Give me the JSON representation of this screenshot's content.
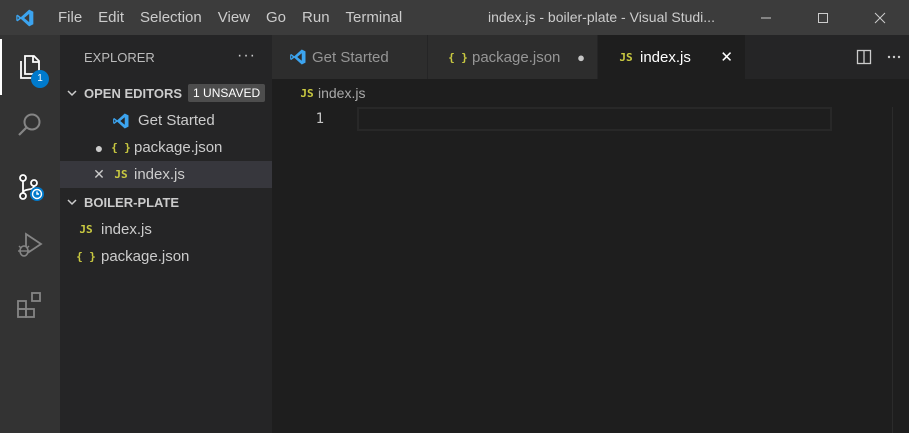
{
  "titlebar": {
    "menu": [
      "File",
      "Edit",
      "Selection",
      "View",
      "Go",
      "Run",
      "Terminal"
    ],
    "window_title": "index.js - boiler-plate - Visual Studi..."
  },
  "activity": {
    "explorer_badge": "1"
  },
  "sidebar": {
    "title": "EXPLORER",
    "more": "···",
    "open_editors": {
      "label": "OPEN EDITORS",
      "badge": "1 UNSAVED",
      "items": [
        {
          "label": "Get Started",
          "icon": "vscode-icon"
        },
        {
          "label": "package.json",
          "icon": "json-icon",
          "lead": "●"
        },
        {
          "label": "index.js",
          "icon": "js-icon",
          "lead": "✕"
        }
      ]
    },
    "project": {
      "label": "BOILER-PLATE",
      "items": [
        {
          "label": "index.js",
          "icon": "js-icon"
        },
        {
          "label": "package.json",
          "icon": "json-icon"
        }
      ]
    }
  },
  "tabs": [
    {
      "label": "Get Started",
      "icon": "vscode-icon"
    },
    {
      "label": "package.json",
      "icon": "json-icon",
      "dirty": "●"
    },
    {
      "label": "index.js",
      "icon": "js-icon",
      "close": "✕"
    }
  ],
  "icon_text": {
    "js": "JS",
    "json": "{ }"
  },
  "breadcrumb": {
    "file": "index.js"
  },
  "editor": {
    "line_numbers": [
      "1"
    ]
  },
  "colors": {
    "accent": "#007acc",
    "js_icon": "#cbcb41",
    "vscode_blue": "#3ca4ef"
  }
}
